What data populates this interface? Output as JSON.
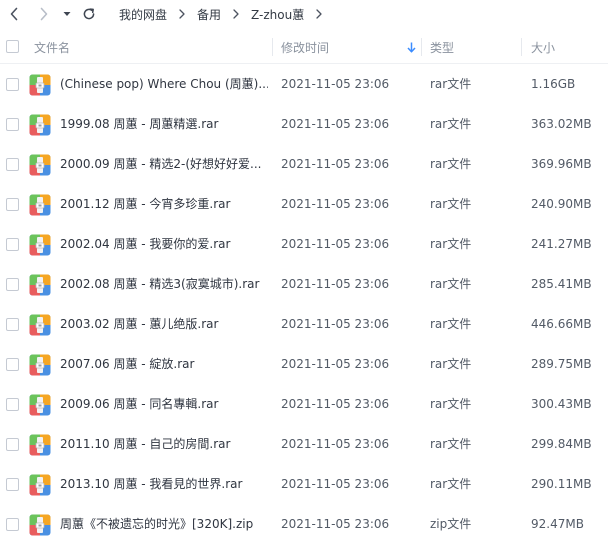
{
  "nav": {
    "back_icon": "chevron-left-icon",
    "forward_icon": "chevron-right-icon",
    "history_icon": "caret-down-icon",
    "refresh_icon": "refresh-icon",
    "breadcrumb": [
      "我的网盘",
      "备用",
      "Z-zhou蕙"
    ]
  },
  "header": {
    "name": "文件名",
    "modified": "修改时间",
    "type": "类型",
    "size": "大小",
    "sort_icon": "arrow-down-icon"
  },
  "colors": {
    "accent": "#3b8cff",
    "icon_blue": "#4a90e2",
    "icon_green": "#6bc35c",
    "icon_orange": "#f5a623",
    "icon_red": "#e85d5d"
  },
  "files": [
    {
      "name": "(Chinese pop) Where Chou (周蕙)...",
      "modified": "2021-11-05 23:06",
      "type": "rar文件",
      "size": "1.16GB"
    },
    {
      "name": "1999.08 周蕙 - 周蕙精選.rar",
      "modified": "2021-11-05 23:06",
      "type": "rar文件",
      "size": "363.02MB"
    },
    {
      "name": "2000.09 周蕙 - 精选2-(好想好好爱...",
      "modified": "2021-11-05 23:06",
      "type": "rar文件",
      "size": "369.96MB"
    },
    {
      "name": "2001.12 周蕙 - 今宵多珍重.rar",
      "modified": "2021-11-05 23:06",
      "type": "rar文件",
      "size": "240.90MB"
    },
    {
      "name": "2002.04 周蕙 - 我要你的爱.rar",
      "modified": "2021-11-05 23:06",
      "type": "rar文件",
      "size": "241.27MB"
    },
    {
      "name": "2002.08 周蕙 - 精选3(寂寞城市).rar",
      "modified": "2021-11-05 23:06",
      "type": "rar文件",
      "size": "285.41MB"
    },
    {
      "name": "2003.02 周蕙 - 蕙儿绝版.rar",
      "modified": "2021-11-05 23:06",
      "type": "rar文件",
      "size": "446.66MB"
    },
    {
      "name": "2007.06 周蕙 - 綻放.rar",
      "modified": "2021-11-05 23:06",
      "type": "rar文件",
      "size": "289.75MB"
    },
    {
      "name": "2009.06 周蕙 - 同名專輯.rar",
      "modified": "2021-11-05 23:06",
      "type": "rar文件",
      "size": "300.43MB"
    },
    {
      "name": "2011.10 周蕙 - 自己的房間.rar",
      "modified": "2021-11-05 23:06",
      "type": "rar文件",
      "size": "299.84MB"
    },
    {
      "name": "2013.10 周蕙 - 我看見的世界.rar",
      "modified": "2021-11-05 23:06",
      "type": "rar文件",
      "size": "290.11MB"
    },
    {
      "name": "周蕙《不被遗忘的时光》[320K].zip",
      "modified": "2021-11-05 23:06",
      "type": "zip文件",
      "size": "92.47MB"
    }
  ]
}
